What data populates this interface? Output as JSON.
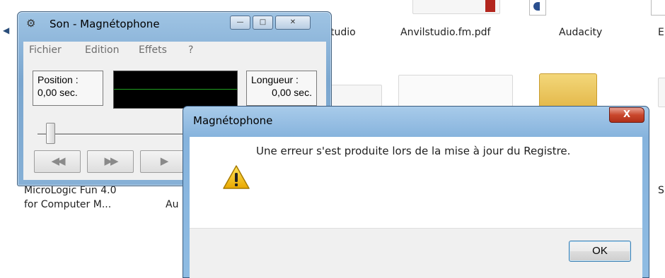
{
  "explorer": {
    "files": [
      {
        "label": "tudio"
      },
      {
        "label": "Anvilstudio.fm.pdf"
      },
      {
        "label": "Audacity"
      },
      {
        "label": "E"
      },
      {
        "label_line1": "MicroLogic Fun 4.0",
        "label_line2": "for Computer M..."
      },
      {
        "label": "Au"
      },
      {
        "label": "S"
      }
    ]
  },
  "recorder": {
    "title": "Son - Magnétophone",
    "menu": [
      "Fichier",
      "Edition",
      "Effets",
      "?"
    ],
    "position_label": "Position :",
    "position_value": "0,00 sec.",
    "length_label": "Longueur :",
    "length_value": "0,00 sec.",
    "buttons": {
      "rewind": "◀◀",
      "forward": "▶▶",
      "play": "▶"
    },
    "slider_position": 0
  },
  "dialog": {
    "title": "Magnétophone",
    "message": "Une erreur s'est produite lors de la mise à jour du Registre.",
    "ok_label": "OK",
    "close_glyph": "X",
    "icon": "warning-icon"
  },
  "colors": {
    "warning_yellow": "#f2c40a",
    "close_red": "#c9472c",
    "waveform_green": "#20a020"
  }
}
